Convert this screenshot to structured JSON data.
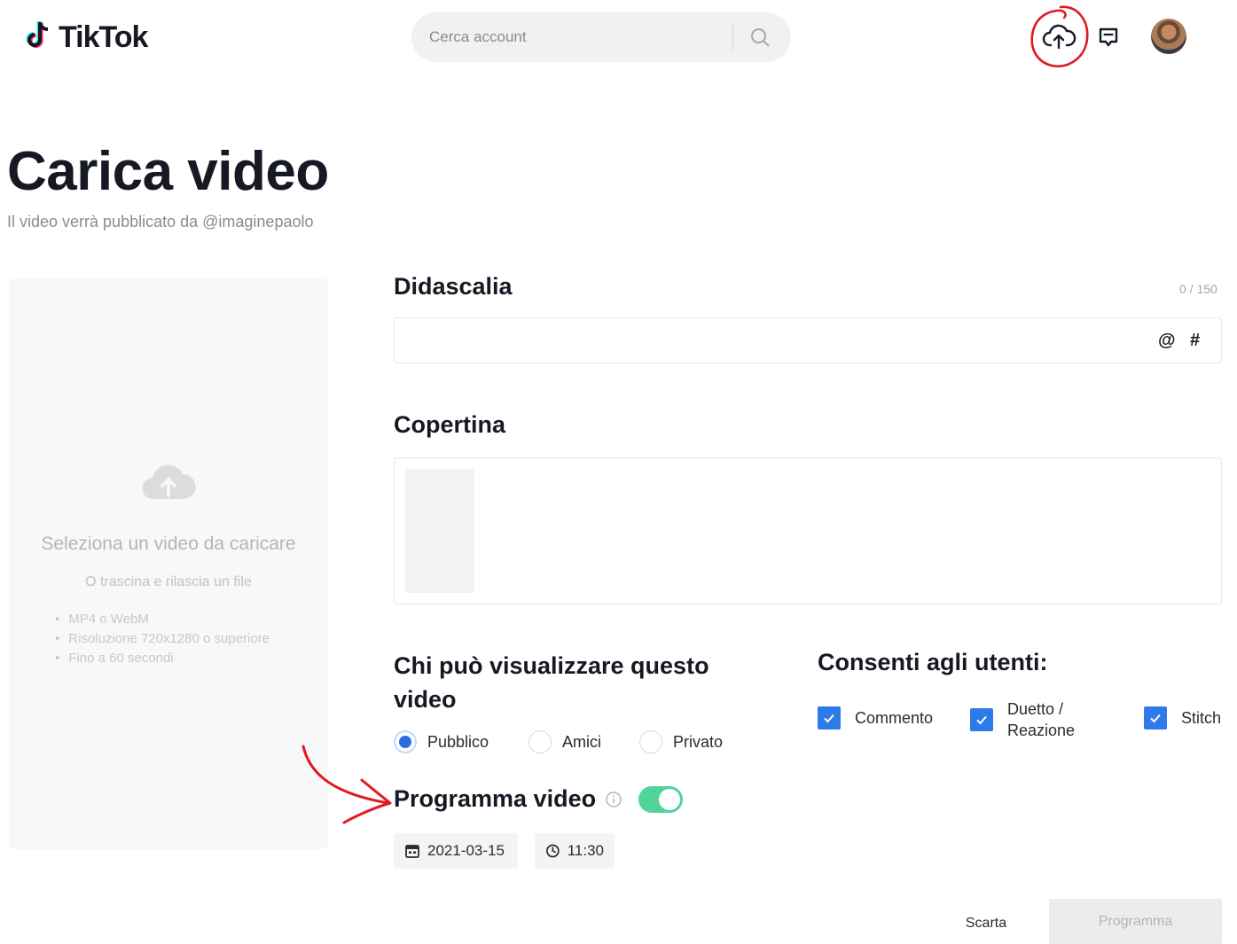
{
  "header": {
    "logo_text": "TikTok",
    "search_placeholder": "Cerca account"
  },
  "page": {
    "title": "Carica video",
    "subtitle": "Il video verrà pubblicato da @imaginepaolo"
  },
  "upload": {
    "title": "Seleziona un video da caricare",
    "subtitle": "O trascina e rilascia un file",
    "requirements": [
      "MP4 o WebM",
      "Risoluzione 720x1280 o superiore",
      "Fino a 60 secondi"
    ]
  },
  "caption": {
    "label": "Didascalia",
    "counter": "0 / 150",
    "value": "",
    "mention_symbol": "@",
    "hashtag_symbol": "#"
  },
  "cover": {
    "label": "Copertina"
  },
  "visibility": {
    "label": "Chi può visualizzare questo video",
    "options": [
      "Pubblico",
      "Amici",
      "Privato"
    ],
    "selected": "Pubblico"
  },
  "consent": {
    "label": "Consenti agli utenti:",
    "options": [
      {
        "label": "Commento",
        "checked": true
      },
      {
        "label": "Duetto / Reazione",
        "checked": true
      },
      {
        "label": "Stitch",
        "checked": true
      }
    ]
  },
  "schedule": {
    "label": "Programma video",
    "enabled": true,
    "date": "2021-03-15",
    "time": "11:30"
  },
  "actions": {
    "discard": "Scarta",
    "submit": "Programma"
  },
  "colors": {
    "accent_blue": "#2d7ae8",
    "toggle_green": "#52d39a",
    "annotation_red": "#e0191f"
  }
}
